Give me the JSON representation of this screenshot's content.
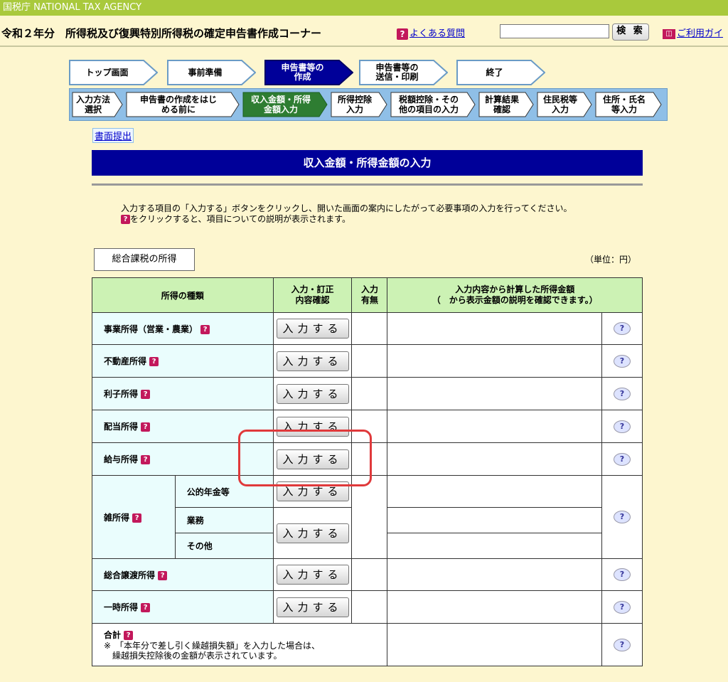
{
  "agency": "国税庁 NATIONAL TAX AGENCY",
  "header": {
    "title": "令和２年分　所得税及び復興特別所得税の確定申告書作成コーナー",
    "faq_label": "よくある質問",
    "search_placeholder": "",
    "search_button": "検 索",
    "guide_label": "ご利用ガイ"
  },
  "steps": [
    {
      "label": "トップ画面",
      "active": false
    },
    {
      "label": "事前準備",
      "active": false
    },
    {
      "label": "申告書等の\n作成",
      "active": true
    },
    {
      "label": "申告書等の\n送信・印刷",
      "active": false
    },
    {
      "label": "終了",
      "active": false
    }
  ],
  "substeps": [
    {
      "label": "入力方法\n選択",
      "active": false
    },
    {
      "label": "申告書の作成をはじ\nめる前に",
      "active": false
    },
    {
      "label": "収入金額・所得\n金額入力",
      "active": true
    },
    {
      "label": "所得控除\n入力",
      "active": false
    },
    {
      "label": "税額控除・その\n他の項目の入力",
      "active": false
    },
    {
      "label": "計算結果\n確認",
      "active": false
    },
    {
      "label": "住民税等\n入力",
      "active": false
    },
    {
      "label": "住所・氏名\n等入力",
      "active": false
    }
  ],
  "submit_link": "書面提出",
  "page_title": "収入金額・所得金額の入力",
  "instructions": {
    "line1": "入力する項目の「入力する」ボタンをクリックし、開いた画面の案内にしたがって必要事項の入力を行ってください。",
    "line2": "をクリックすると、項目についての説明が表示されます。"
  },
  "category": "総合課税の所得",
  "unit": "（単位：円）",
  "table": {
    "headers": {
      "kind": "所得の種類",
      "input": "入力・訂正\n内容確認",
      "has_input": "入力\n有無",
      "amount": "入力内容から計算した所得金額\n（　から表示金額の説明を確認できます。）"
    },
    "button_label": "入力する",
    "rows": {
      "business": "事業所得（営業・農業）",
      "real_estate": "不動産所得",
      "interest": "利子所得",
      "dividend": "配当所得",
      "salary": "給与所得",
      "misc": "雑所得",
      "misc_pension": "公的年金等",
      "misc_business": "業務",
      "misc_other": "その他",
      "transfer": "総合譲渡所得",
      "temporary": "一時所得",
      "total": "合計",
      "total_note1": "※　「本年分で差し引く繰越損失額」を入力した場合は、",
      "total_note2": "　繰越損失控除後の金額が表示されています。"
    }
  },
  "colors": {
    "title_bg": "#000099",
    "header_green": "#ccf2b4",
    "kind_bg": "#eafdfd",
    "active_step": "#000099",
    "highlight": "#e0393b"
  }
}
